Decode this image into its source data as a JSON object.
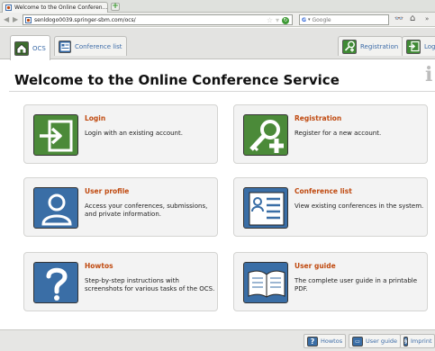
{
  "browser": {
    "tab_title": "Welcome to the Online Conferen...",
    "url": "senldogo0039.springer-sbm.com/ocs/",
    "search_placeholder": "Google"
  },
  "app_tabs": {
    "ocs": "OCS",
    "conference_list": "Conference list",
    "registration": "Registration",
    "login": "Login"
  },
  "page": {
    "title": "Welcome to the Online Conference Service",
    "info_glyph": "i"
  },
  "cards": {
    "login": {
      "title": "Login",
      "desc": "Login with an existing account."
    },
    "registration": {
      "title": "Registration",
      "desc": "Register for a new account."
    },
    "user_profile": {
      "title": "User profile",
      "desc": "Access your conferences, submissions, and private information."
    },
    "conference_list": {
      "title": "Conference list",
      "desc": "View existing conferences in the system."
    },
    "howtos": {
      "title": "Howtos",
      "desc": "Step-by-step instructions with screenshots for various tasks of the OCS."
    },
    "user_guide": {
      "title": "User guide",
      "desc": "The complete user guide in a printable PDF."
    }
  },
  "footer": {
    "howtos": "Howtos",
    "user_guide": "User guide",
    "imprint": "Imprint"
  },
  "colors": {
    "link": "#3d6ca8",
    "card_title": "#c04a10",
    "green_icon": "#4b8a39",
    "blue_icon": "#3a6ea6"
  }
}
